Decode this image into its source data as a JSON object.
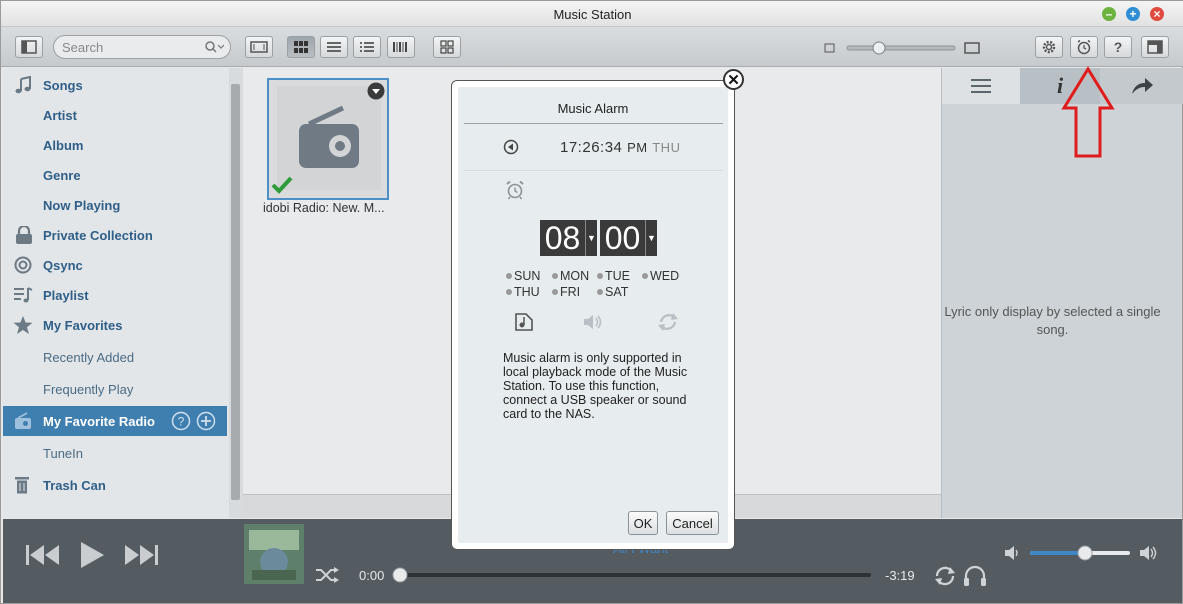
{
  "window": {
    "title": "Music Station"
  },
  "toolbar": {
    "search_placeholder": "Search",
    "colors": {
      "accent": "#3f7fb0"
    }
  },
  "sidebar": {
    "items": [
      {
        "label": "Songs",
        "icon": "music-note-icon"
      },
      {
        "label": "Artist"
      },
      {
        "label": "Album"
      },
      {
        "label": "Genre"
      },
      {
        "label": "Now Playing"
      },
      {
        "label": "Private Collection",
        "icon": "lock-icon"
      },
      {
        "label": "Qsync",
        "icon": "sync-icon"
      },
      {
        "label": "Playlist",
        "icon": "playlist-icon"
      },
      {
        "label": "My Favorites",
        "icon": "star-icon"
      },
      {
        "label": "Recently Added"
      },
      {
        "label": "Frequently Play"
      },
      {
        "label": "My Favorite Radio",
        "icon": "radio-icon",
        "selected": true
      },
      {
        "label": "TuneIn"
      },
      {
        "label": "Trash Can",
        "icon": "trash-icon"
      }
    ]
  },
  "content": {
    "tile": {
      "label": "idobi Radio: New. M..."
    }
  },
  "right_panel": {
    "lyric_text": "Lyric only display by selected a single song."
  },
  "dialog": {
    "title": "Music Alarm",
    "current_time": "17:26:34",
    "current_ampm": "PM",
    "current_day": "THU",
    "alarm_hour": "08",
    "alarm_minute": "00",
    "days": [
      "SUN",
      "MON",
      "TUE",
      "WED",
      "THU",
      "FRI",
      "SAT"
    ],
    "message": "Music alarm is only supported in local playback mode of the Music Station. To use this function, connect a USB speaker or sound card to the NAS.",
    "ok_label": "OK",
    "cancel_label": "Cancel"
  },
  "player": {
    "song_title": "All I Want",
    "elapsed": "0:00",
    "remaining": "-3:19",
    "progress_fraction": 0.0,
    "volume_fraction": 0.55
  }
}
